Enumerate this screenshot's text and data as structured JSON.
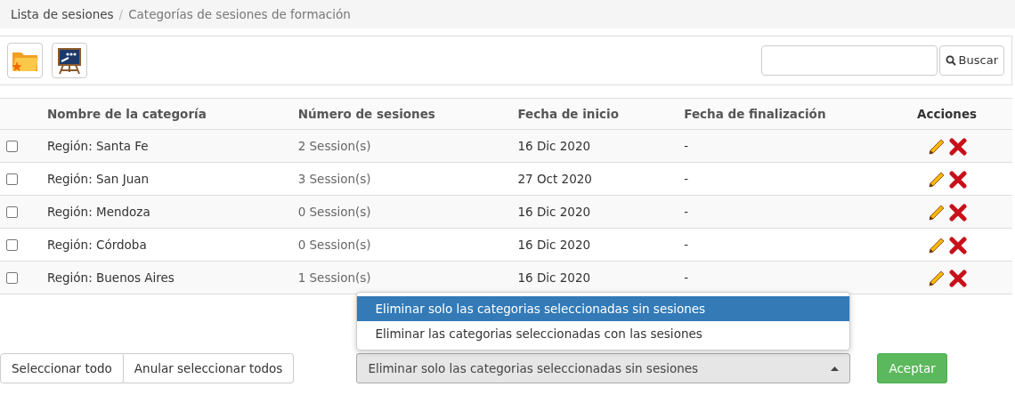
{
  "breadcrumb_separator": "/",
  "breadcrumb": [
    {
      "label": "Lista de sesiones",
      "active": false
    },
    {
      "label": "Categorías de sesiones de formación",
      "active": true
    }
  ],
  "toolbar": {
    "search": {
      "button": "Buscar"
    }
  },
  "table": {
    "columns": [
      "Nombre de la categoría",
      "Número de sesiones",
      "Fecha de inicio",
      "Fecha de finalización",
      "Acciones"
    ],
    "rows": [
      {
        "checked": false,
        "name": "Región: Santa Fe",
        "sessions": "2 Session(s)",
        "start": "16 Dic 2020",
        "end": "-"
      },
      {
        "checked": false,
        "name": "Región: San Juan",
        "sessions": "3 Session(s)",
        "start": "27 Oct 2020",
        "end": "-"
      },
      {
        "checked": false,
        "name": "Región: Mendoza",
        "sessions": "0 Session(s)",
        "start": "16 Dic 2020",
        "end": "-"
      },
      {
        "checked": false,
        "name": "Región: Córdoba",
        "sessions": "0 Session(s)",
        "start": "16 Dic 2020",
        "end": "-"
      },
      {
        "checked": false,
        "name": "Región: Buenos Aires",
        "sessions": "1 Session(s)",
        "start": "16 Dic 2020",
        "end": "-"
      }
    ]
  },
  "footer": {
    "select_buttons": [
      "Seleccionar todo",
      "Anular seleccionar todos"
    ],
    "action_select": {
      "value": "Eliminar solo las categorias seleccionadas sin sesiones",
      "expanded": true,
      "options": [
        {
          "label": "Eliminar solo las categorias seleccionadas sin sesiones",
          "selected": true
        },
        {
          "label": "Eliminar las categorias seleccionadas con las sesiones",
          "selected": false
        }
      ]
    },
    "submit": "Aceptar"
  }
}
